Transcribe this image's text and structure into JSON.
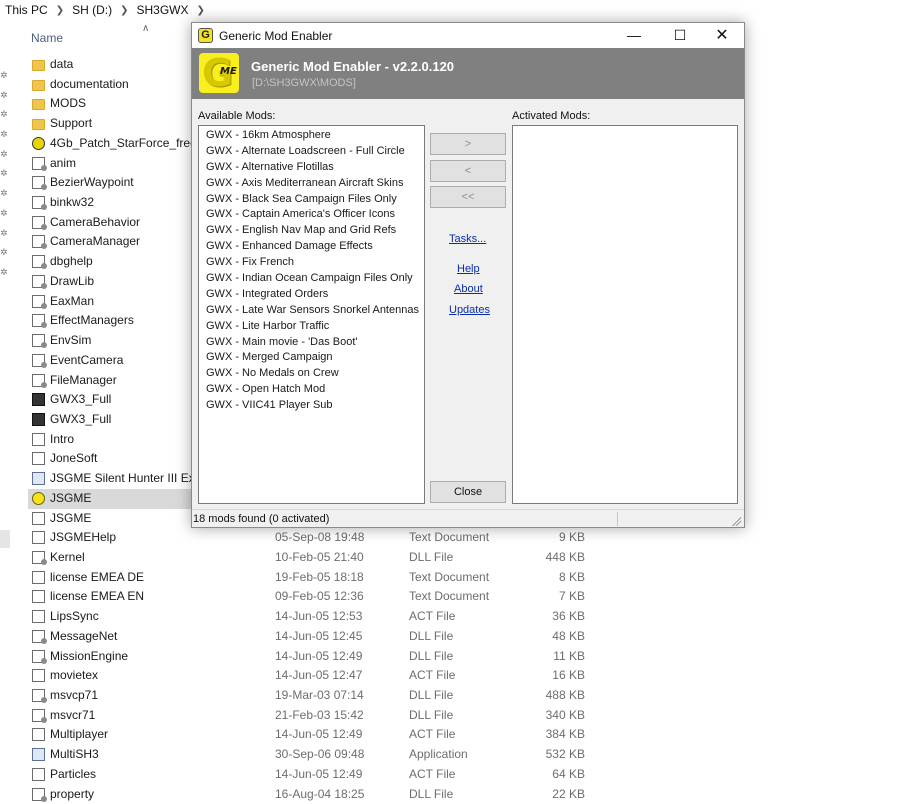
{
  "explorer": {
    "breadcrumb": [
      "This PC",
      "SH (D:)",
      "SH3GWX"
    ],
    "column_name": "Name",
    "files": [
      {
        "name": "data",
        "icon": "folder-icon",
        "date": "",
        "type": "",
        "size": ""
      },
      {
        "name": "documentation",
        "icon": "folder-icon",
        "date": "",
        "type": "",
        "size": ""
      },
      {
        "name": "MODS",
        "icon": "folder-icon",
        "date": "",
        "type": "",
        "size": ""
      },
      {
        "name": "Support",
        "icon": "folder-icon",
        "date": "",
        "type": "",
        "size": ""
      },
      {
        "name": "4Gb_Patch_StarForce_free",
        "icon": "crosshair-app-icon",
        "date": "",
        "type": "",
        "size": ""
      },
      {
        "name": "anim",
        "icon": "dll-file-icon",
        "date": "",
        "type": "",
        "size": ""
      },
      {
        "name": "BezierWaypoint",
        "icon": "dll-file-icon",
        "date": "",
        "type": "",
        "size": ""
      },
      {
        "name": "binkw32",
        "icon": "dll-file-icon",
        "date": "",
        "type": "",
        "size": ""
      },
      {
        "name": "CameraBehavior",
        "icon": "dll-file-icon",
        "date": "",
        "type": "",
        "size": ""
      },
      {
        "name": "CameraManager",
        "icon": "dll-file-icon",
        "date": "",
        "type": "",
        "size": ""
      },
      {
        "name": "dbghelp",
        "icon": "dll-file-icon",
        "date": "",
        "type": "",
        "size": ""
      },
      {
        "name": "DrawLib",
        "icon": "dll-file-icon",
        "date": "",
        "type": "",
        "size": ""
      },
      {
        "name": "EaxMan",
        "icon": "dll-file-icon",
        "date": "",
        "type": "",
        "size": ""
      },
      {
        "name": "EffectManagers",
        "icon": "dll-file-icon",
        "date": "",
        "type": "",
        "size": ""
      },
      {
        "name": "EnvSim",
        "icon": "dll-file-icon",
        "date": "",
        "type": "",
        "size": ""
      },
      {
        "name": "EventCamera",
        "icon": "dll-file-icon",
        "date": "",
        "type": "",
        "size": ""
      },
      {
        "name": "FileManager",
        "icon": "dll-file-icon",
        "date": "",
        "type": "",
        "size": ""
      },
      {
        "name": "GWX3_Full",
        "icon": "app-dark-icon",
        "date": "",
        "type": "",
        "size": ""
      },
      {
        "name": "GWX3_Full",
        "icon": "app-dark-icon",
        "date": "",
        "type": "",
        "size": ""
      },
      {
        "name": "Intro",
        "icon": "document-icon",
        "date": "",
        "type": "",
        "size": ""
      },
      {
        "name": "JoneSoft",
        "icon": "document-icon",
        "date": "",
        "type": "",
        "size": ""
      },
      {
        "name": "JSGME Silent Hunter III Explo",
        "icon": "shortcut-icon",
        "date": "",
        "type": "",
        "size": ""
      },
      {
        "name": "JSGME",
        "icon": "jsgme-icon",
        "date": "",
        "type": "",
        "size": ""
      },
      {
        "name": "JSGME",
        "icon": "document-icon",
        "date": "",
        "type": "",
        "size": ""
      },
      {
        "name": "JSGMEHelp",
        "icon": "document-icon",
        "date": "05-Sep-08 19:48",
        "type": "Text Document",
        "size": "9 KB"
      },
      {
        "name": "Kernel",
        "icon": "dll-file-icon",
        "date": "10-Feb-05 21:40",
        "type": "DLL File",
        "size": "448 KB"
      },
      {
        "name": "license EMEA DE",
        "icon": "document-icon",
        "date": "19-Feb-05 18:18",
        "type": "Text Document",
        "size": "8 KB"
      },
      {
        "name": "license EMEA EN",
        "icon": "document-icon",
        "date": "09-Feb-05 12:36",
        "type": "Text Document",
        "size": "7 KB"
      },
      {
        "name": "LipsSync",
        "icon": "document-icon",
        "date": "14-Jun-05 12:53",
        "type": "ACT File",
        "size": "36 KB"
      },
      {
        "name": "MessageNet",
        "icon": "dll-file-icon",
        "date": "14-Jun-05 12:45",
        "type": "DLL File",
        "size": "48 KB"
      },
      {
        "name": "MissionEngine",
        "icon": "dll-file-icon",
        "date": "14-Jun-05 12:49",
        "type": "DLL File",
        "size": "11 KB"
      },
      {
        "name": "movietex",
        "icon": "document-icon",
        "date": "14-Jun-05 12:47",
        "type": "ACT File",
        "size": "16 KB"
      },
      {
        "name": "msvcp71",
        "icon": "dll-file-icon",
        "date": "19-Mar-03 07:14",
        "type": "DLL File",
        "size": "488 KB"
      },
      {
        "name": "msvcr71",
        "icon": "dll-file-icon",
        "date": "21-Feb-03 15:42",
        "type": "DLL File",
        "size": "340 KB"
      },
      {
        "name": "Multiplayer",
        "icon": "document-icon",
        "date": "14-Jun-05 12:49",
        "type": "ACT File",
        "size": "384 KB"
      },
      {
        "name": "MultiSH3",
        "icon": "exe-icon",
        "date": "30-Sep-06 09:48",
        "type": "Application",
        "size": "532 KB"
      },
      {
        "name": "Particles",
        "icon": "document-icon",
        "date": "14-Jun-05 12:49",
        "type": "ACT File",
        "size": "64 KB"
      },
      {
        "name": "property",
        "icon": "dll-file-icon",
        "date": "16-Aug-04 18:25",
        "type": "DLL File",
        "size": "22 KB"
      }
    ]
  },
  "dialog": {
    "title": "Generic Mod Enabler",
    "banner_title": "Generic Mod Enabler - v2.2.0.120",
    "banner_path": "[D:\\SH3GWX\\MODS]",
    "logo_letter": "G",
    "logo_sub": "ME",
    "available_label": "Available Mods:",
    "activated_label": "Activated Mods:",
    "available_mods": [
      "GWX - 16km Atmosphere",
      "GWX - Alternate Loadscreen - Full Circle",
      "GWX - Alternative Flotillas",
      "GWX - Axis Mediterranean Aircraft Skins",
      "GWX - Black Sea Campaign Files Only",
      "GWX - Captain America's Officer Icons",
      "GWX - English Nav Map and Grid Refs",
      "GWX - Enhanced Damage Effects",
      "GWX - Fix French",
      "GWX - Indian Ocean Campaign Files Only",
      "GWX - Integrated Orders",
      "GWX - Late War Sensors Snorkel Antennas",
      "GWX - Lite Harbor Traffic",
      "GWX - Main movie - 'Das Boot'",
      "GWX - Merged Campaign",
      "GWX - No Medals on Crew",
      "GWX - Open Hatch Mod",
      "GWX - VIIC41 Player Sub"
    ],
    "activated_mods": [],
    "buttons": {
      "add": ">",
      "remove": "<",
      "remove_all": "<<",
      "close": "Close"
    },
    "links": {
      "tasks": "Tasks...",
      "help": "Help",
      "about": "About",
      "updates": "Updates"
    },
    "status": "18 mods found (0 activated)",
    "window_controls": {
      "minimize": "—",
      "maximize": "☐",
      "close": "✕"
    }
  }
}
